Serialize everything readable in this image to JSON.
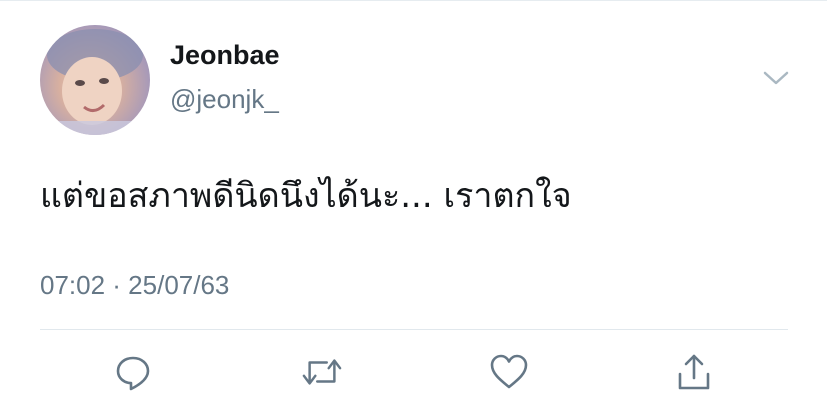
{
  "tweet": {
    "author": {
      "display_name": "Jeonbae",
      "handle": "@jeonjk_"
    },
    "text": "แต่ขอสภาพดีนิดนึงได้นะ... เราตกใจ",
    "timestamp": "07:02 · 25/07/63"
  },
  "icons": {
    "menu": "chevron-down-icon",
    "reply": "reply-icon",
    "retweet": "retweet-icon",
    "like": "heart-icon",
    "share": "share-icon"
  },
  "colors": {
    "primary_text": "#14171a",
    "secondary_text": "#657786",
    "icon": "#657786",
    "divider": "#e1e8ed"
  }
}
